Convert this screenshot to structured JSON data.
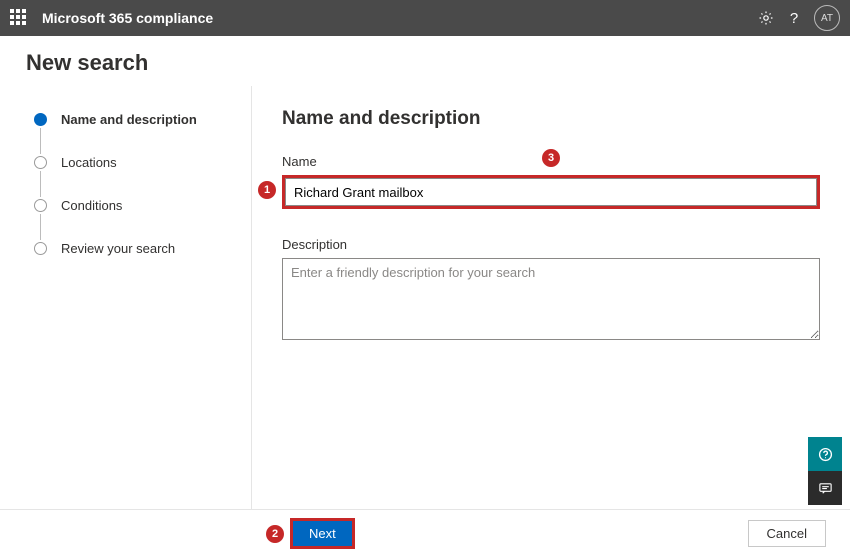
{
  "header": {
    "brand": "Microsoft 365 compliance",
    "avatar_initials": "AT"
  },
  "page": {
    "title": "New search"
  },
  "wizard": {
    "steps": [
      {
        "label": "Name and description",
        "active": true
      },
      {
        "label": "Locations",
        "active": false
      },
      {
        "label": "Conditions",
        "active": false
      },
      {
        "label": "Review your search",
        "active": false
      }
    ]
  },
  "form": {
    "section_title": "Name and description",
    "name_label": "Name",
    "name_value": "Richard Grant mailbox",
    "description_label": "Description",
    "description_placeholder": "Enter a friendly description for your search",
    "description_value": ""
  },
  "footer": {
    "next_label": "Next",
    "cancel_label": "Cancel"
  },
  "callouts": {
    "c1": "1",
    "c2": "2",
    "c3": "3"
  }
}
